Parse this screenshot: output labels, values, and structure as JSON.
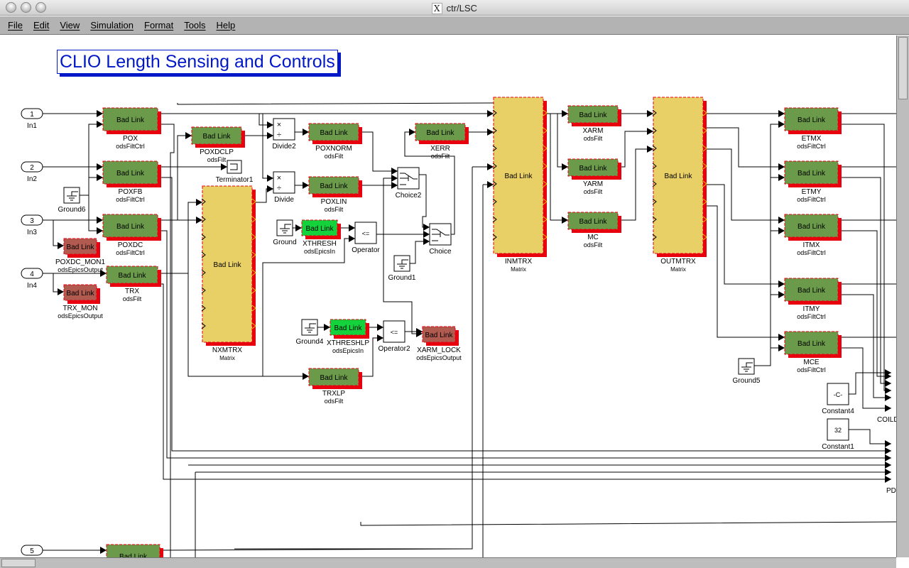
{
  "window": {
    "title": "ctr/LSC",
    "x_icon": "X"
  },
  "menu": [
    "File",
    "Edit",
    "View",
    "Simulation",
    "Format",
    "Tools",
    "Help"
  ],
  "diagram_title": "CLIO Length Sensing and Controls",
  "block_text": "Bad Link",
  "colors": {
    "filt": "#6a9a4a",
    "epics_in": "#14d23c",
    "epics_out": "#b05a50",
    "matrix": "#e8cf66",
    "shadow": "#e8000f",
    "title": "#0018c8"
  },
  "blocks": [
    {
      "name": "POX",
      "type": "odsFiltCtrl",
      "kind": "filt"
    },
    {
      "name": "POXFB",
      "type": "odsFiltCtrl",
      "kind": "filt"
    },
    {
      "name": "POXDC",
      "type": "odsFiltCtrl",
      "kind": "filt"
    },
    {
      "name": "POXDCLP",
      "type": "odsFilt",
      "kind": "filt"
    },
    {
      "name": "TRX",
      "type": "odsFilt",
      "kind": "filt"
    },
    {
      "name": "POXDC_MON1",
      "type": "odsEpicsOutput",
      "kind": "epics_out"
    },
    {
      "name": "TRX_MON",
      "type": "odsEpicsOutput",
      "kind": "epics_out"
    },
    {
      "name": "NXMTRX",
      "type": "Matrix",
      "kind": "matrix"
    },
    {
      "name": "POXNORM",
      "type": "odsFilt",
      "kind": "filt"
    },
    {
      "name": "POXLIN",
      "type": "odsFilt",
      "kind": "filt"
    },
    {
      "name": "XTHRESH",
      "type": "odsEpicsIn",
      "kind": "epics_in"
    },
    {
      "name": "XTHRESHLP",
      "type": "odsEpicsIn",
      "kind": "epics_in"
    },
    {
      "name": "XARM_LOCK",
      "type": "odsEpicsOutput",
      "kind": "epics_out"
    },
    {
      "name": "TRXLP",
      "type": "odsFilt",
      "kind": "filt"
    },
    {
      "name": "XERR",
      "type": "odsFilt",
      "kind": "filt"
    },
    {
      "name": "INMTRX",
      "type": "Matrix",
      "kind": "matrix"
    },
    {
      "name": "XARM",
      "type": "odsFilt",
      "kind": "filt"
    },
    {
      "name": "YARM",
      "type": "odsFilt",
      "kind": "filt"
    },
    {
      "name": "MC",
      "type": "odsFilt",
      "kind": "filt"
    },
    {
      "name": "OUTMTRX",
      "type": "Matrix",
      "kind": "matrix"
    },
    {
      "name": "ETMX",
      "type": "odsFiltCtrl",
      "kind": "filt"
    },
    {
      "name": "ETMY",
      "type": "odsFiltCtrl",
      "kind": "filt"
    },
    {
      "name": "ITMX",
      "type": "odsFiltCtrl",
      "kind": "filt"
    },
    {
      "name": "ITMY",
      "type": "odsFiltCtrl",
      "kind": "filt"
    },
    {
      "name": "MCE",
      "type": "odsFiltCtrl",
      "kind": "filt"
    },
    {
      "name": "",
      "type": "",
      "kind": "filt"
    }
  ],
  "inports": [
    {
      "num": "1",
      "name": "In1"
    },
    {
      "num": "2",
      "name": "In2"
    },
    {
      "num": "3",
      "name": "In3"
    },
    {
      "num": "4",
      "name": "In4"
    },
    {
      "num": "5",
      "name": ""
    }
  ],
  "simple_blocks": [
    {
      "name": "Ground6",
      "glyph": "ground"
    },
    {
      "name": "Terminator1",
      "glyph": "terminator"
    },
    {
      "name": "Divide2",
      "glyph": "divide"
    },
    {
      "name": "Divide",
      "glyph": "divide"
    },
    {
      "name": "Ground",
      "glyph": "ground"
    },
    {
      "name": "Operator",
      "glyph": "<="
    },
    {
      "name": "Choice2",
      "glyph": "switch"
    },
    {
      "name": "Choice",
      "glyph": "switch"
    },
    {
      "name": "Ground1",
      "glyph": "ground"
    },
    {
      "name": "Ground4",
      "glyph": "ground"
    },
    {
      "name": "Operator2",
      "glyph": "<="
    },
    {
      "name": "Ground5",
      "glyph": "ground"
    },
    {
      "name": "Constant4",
      "glyph": "-C-"
    },
    {
      "name": "Constant1",
      "glyph": "32"
    }
  ],
  "edge_labels": [
    "COILD",
    "PD"
  ]
}
